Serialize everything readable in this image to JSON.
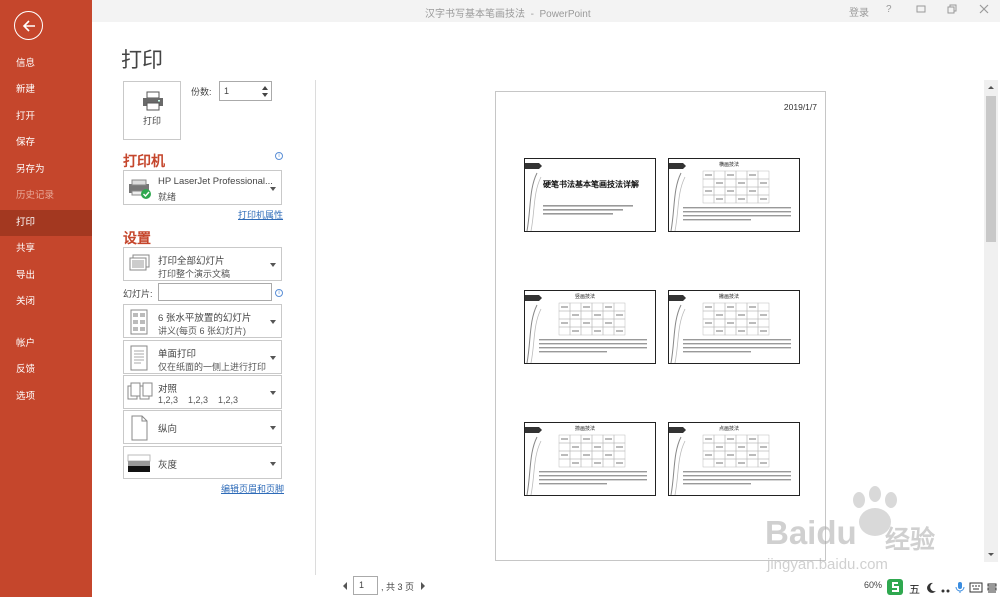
{
  "window": {
    "title": "汉字书写基本笔画技法",
    "app": "PowerPoint",
    "separator": "-",
    "signin": "登录",
    "help": "?"
  },
  "sidebar": {
    "items": [
      {
        "label": "信息"
      },
      {
        "label": "新建"
      },
      {
        "label": "打开"
      },
      {
        "label": "保存"
      },
      {
        "label": "另存为"
      },
      {
        "label": "历史记录"
      },
      {
        "label": "打印"
      },
      {
        "label": "共享"
      },
      {
        "label": "导出"
      },
      {
        "label": "关闭"
      },
      {
        "label": "帐户"
      },
      {
        "label": "反馈"
      },
      {
        "label": "选项"
      }
    ],
    "active_index": 6,
    "color": "#c5462c"
  },
  "print": {
    "title": "打印",
    "button_label": "打印",
    "copies_label": "份数:",
    "copies_value": "1"
  },
  "printer": {
    "section": "打印机",
    "name": "HP LaserJet Professional...",
    "status": "就绪",
    "properties_link": "打印机属性"
  },
  "settings": {
    "section": "设置",
    "range": {
      "title": "打印全部幻灯片",
      "sub": "打印整个演示文稿"
    },
    "slides_label": "幻灯片:",
    "slides_value": "",
    "layout": {
      "title": "6 张水平放置的幻灯片",
      "sub": "讲义(每页 6 张幻灯片)"
    },
    "sides": {
      "title": "单面打印",
      "sub": "仅在纸面的一侧上进行打印"
    },
    "collate": {
      "title": "对照",
      "sub": "1,2,3    1,2,3    1,2,3"
    },
    "orientation": {
      "title": "纵向"
    },
    "color": {
      "title": "灰度"
    },
    "header_footer_link": "编辑页眉和页脚"
  },
  "preview": {
    "date": "2019/1/7",
    "slides": [
      {
        "title": "硬笔书法基本笔画技法详解"
      },
      {
        "title": "横画技法"
      },
      {
        "title": "竖画技法"
      },
      {
        "title": "撇画技法"
      },
      {
        "title": "捺画技法"
      },
      {
        "title": "点画技法"
      }
    ]
  },
  "pager": {
    "current": "1",
    "total_text": ", 共 3 页"
  },
  "status": {
    "zoom": "60%",
    "ime": "五"
  },
  "watermark": {
    "brand": "Baidu",
    "cn": "经验",
    "url": "jingyan.baidu.com"
  }
}
